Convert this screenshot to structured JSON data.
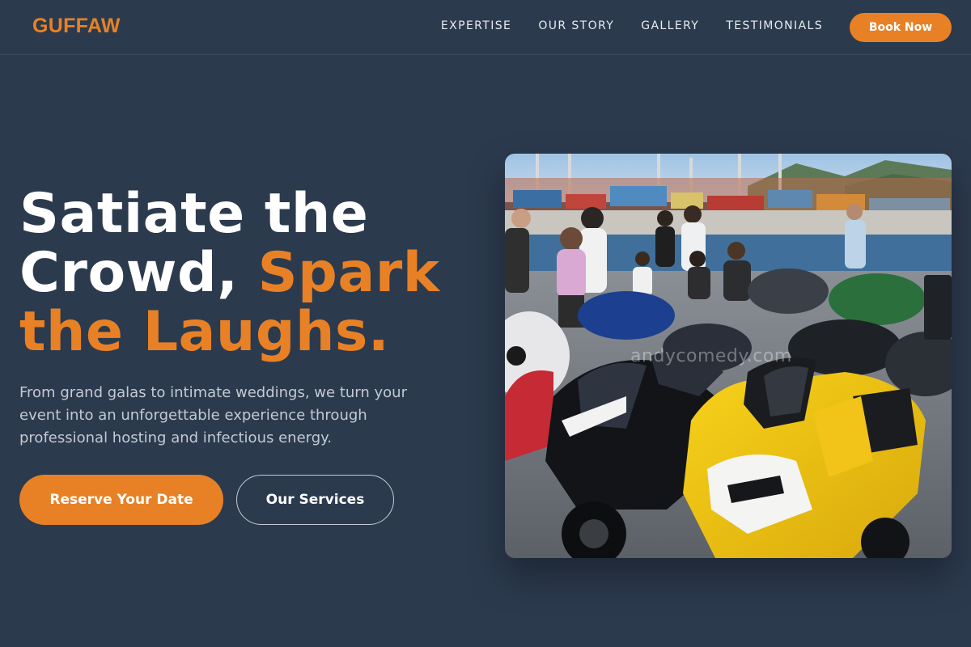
{
  "header": {
    "logo": "GUFFAW",
    "nav": [
      "EXPERTISE",
      "OUR STORY",
      "GALLERY",
      "TESTIMONIALS"
    ],
    "cta": "Book Now"
  },
  "hero": {
    "title_line1": "Satiate the",
    "title_line2_plain": "Crowd, ",
    "title_line2_accent": "Spark",
    "title_line3_accent": "the Laughs.",
    "description": "From grand galas to intimate weddings, we turn your event into an unforgettable experience through professional hosting and infectious energy.",
    "primary_button": "Reserve Your Date",
    "secondary_button": "Our Services"
  },
  "image": {
    "watermark": "andycomedy.com"
  },
  "colors": {
    "background": "#2c3a4e",
    "accent": "#e88125",
    "text": "#ffffff",
    "muted_text": "#c3cad3"
  }
}
